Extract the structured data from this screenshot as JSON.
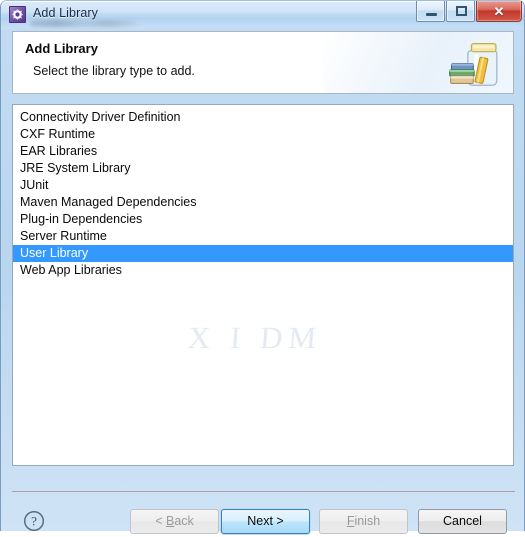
{
  "window": {
    "title": "Add Library",
    "app_icon": "gear-icon",
    "controls": {
      "minimize": "minimize-icon",
      "maximize": "maximize-icon",
      "close": "✕"
    }
  },
  "banner": {
    "title": "Add Library",
    "description": "Select the library type to add.",
    "icon": "library-jar-books-icon"
  },
  "list": {
    "watermark": "X  I  DM",
    "items": [
      {
        "label": "Connectivity Driver Definition",
        "selected": false
      },
      {
        "label": "CXF Runtime",
        "selected": false
      },
      {
        "label": "EAR Libraries",
        "selected": false
      },
      {
        "label": "JRE System Library",
        "selected": false
      },
      {
        "label": "JUnit",
        "selected": false
      },
      {
        "label": "Maven Managed Dependencies",
        "selected": false
      },
      {
        "label": "Plug-in Dependencies",
        "selected": false
      },
      {
        "label": "Server Runtime",
        "selected": false
      },
      {
        "label": "User Library",
        "selected": true
      },
      {
        "label": "Web App Libraries",
        "selected": false
      }
    ],
    "selected_value": "User Library"
  },
  "buttons": {
    "help": "?",
    "back": {
      "label": "< Back",
      "mnemonic": "B",
      "enabled": false
    },
    "next": {
      "label": "Next >",
      "mnemonic": "N",
      "enabled": true,
      "default": true
    },
    "finish": {
      "label": "Finish",
      "mnemonic": "F",
      "enabled": false
    },
    "cancel": {
      "label": "Cancel",
      "enabled": true
    }
  },
  "colors": {
    "selection": "#3399ff",
    "titlebar": "#bcd8f2",
    "close_button": "#c0392b",
    "default_button_border": "#3c7fb1"
  }
}
